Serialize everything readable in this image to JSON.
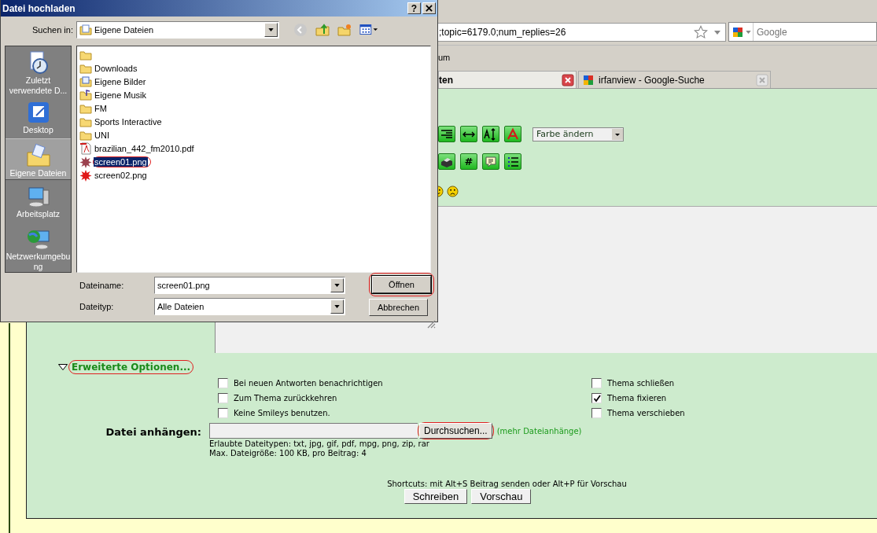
{
  "browser": {
    "url": ";topic=6179.0;num_replies=26",
    "search": {
      "placeholder": "Google"
    },
    "bookmarks": [
      "um"
    ],
    "tabs": [
      {
        "label": "ten",
        "selected": true
      },
      {
        "label": "irfanview - Google-Suche",
        "selected": false
      }
    ]
  },
  "editor": {
    "toolbar_rows": [
      [
        {
          "kind": "align-right"
        },
        {
          "kind": "rule"
        },
        {
          "kind": "font-size"
        },
        {
          "kind": "font-color"
        }
      ],
      [
        {
          "kind": "printer"
        },
        {
          "kind": "glyph",
          "glyph": "#"
        },
        {
          "kind": "quote"
        },
        {
          "kind": "list"
        }
      ]
    ],
    "color_select": "Farbe ändern",
    "smileys": [
      {
        "kind": "smile"
      },
      {
        "kind": "sad"
      }
    ]
  },
  "options": {
    "toggle": "Erweiterte Optionen...",
    "expanded": true,
    "left": [
      {
        "label": "Bei neuen Antworten benachrichtigen",
        "checked": false
      },
      {
        "label": "Zum Thema zurückkehren",
        "checked": false
      },
      {
        "label": "Keine Smileys benutzen.",
        "checked": false
      }
    ],
    "right": [
      {
        "label": "Thema schließen",
        "checked": false
      },
      {
        "label": "Thema fixieren",
        "checked": true
      },
      {
        "label": "Thema verschieben",
        "checked": false
      }
    ]
  },
  "attach": {
    "label": "Datei anhängen:",
    "browse": "Durchsuchen...",
    "more": "(mehr Dateianhänge)",
    "info": [
      "Erlaubte Dateitypen: txt, jpg, gif, pdf, mpg, png, zip, rar",
      "Max. Dateigröße: 100 KB, pro Beitrag: 4"
    ]
  },
  "shortcuts": "Shortcuts: mit Alt+S Beitrag senden oder Alt+P für Vorschau",
  "buttons": [
    "Schreiben",
    "Vorschau"
  ],
  "dialog": {
    "title": "Datei hochladen",
    "help": "?",
    "look_in_label": "Suchen in:",
    "look_in": "Eigene Dateien",
    "places": [
      {
        "label": "Zuletzt verwendete D...",
        "kind": "recent",
        "selected": false
      },
      {
        "label": "Desktop",
        "kind": "desktop",
        "selected": false
      },
      {
        "label": "Eigene Dateien",
        "kind": "documents",
        "selected": true
      },
      {
        "label": "Arbeitsplatz",
        "kind": "computer",
        "selected": false
      },
      {
        "label": "Netzwerkumgebung",
        "kind": "network",
        "selected": false
      }
    ],
    "files": [
      {
        "kind": "folder",
        "selected": false
      },
      {
        "name": "Downloads",
        "kind": "folder",
        "selected": false
      },
      {
        "name": "Eigene Bilder",
        "kind": "pictures",
        "selected": false
      },
      {
        "name": "Eigene Musik",
        "kind": "music",
        "selected": false
      },
      {
        "name": "FM",
        "kind": "folder",
        "selected": false
      },
      {
        "name": "Sports Interactive",
        "kind": "folder",
        "selected": false
      },
      {
        "name": "UNI",
        "kind": "folder",
        "selected": false
      },
      {
        "name": "brazilian_442_fm2010.pdf",
        "kind": "pdf",
        "selected": false
      },
      {
        "name": "screen01.png",
        "kind": "image",
        "selected": true
      },
      {
        "name": "screen02.png",
        "kind": "image",
        "selected": false
      }
    ],
    "filename_label": "Dateiname:",
    "filename": "screen01.png",
    "filetype_label": "Dateityp:",
    "filetype": "Alle Dateien",
    "open": "Öffnen",
    "cancel": "Abbrechen"
  }
}
